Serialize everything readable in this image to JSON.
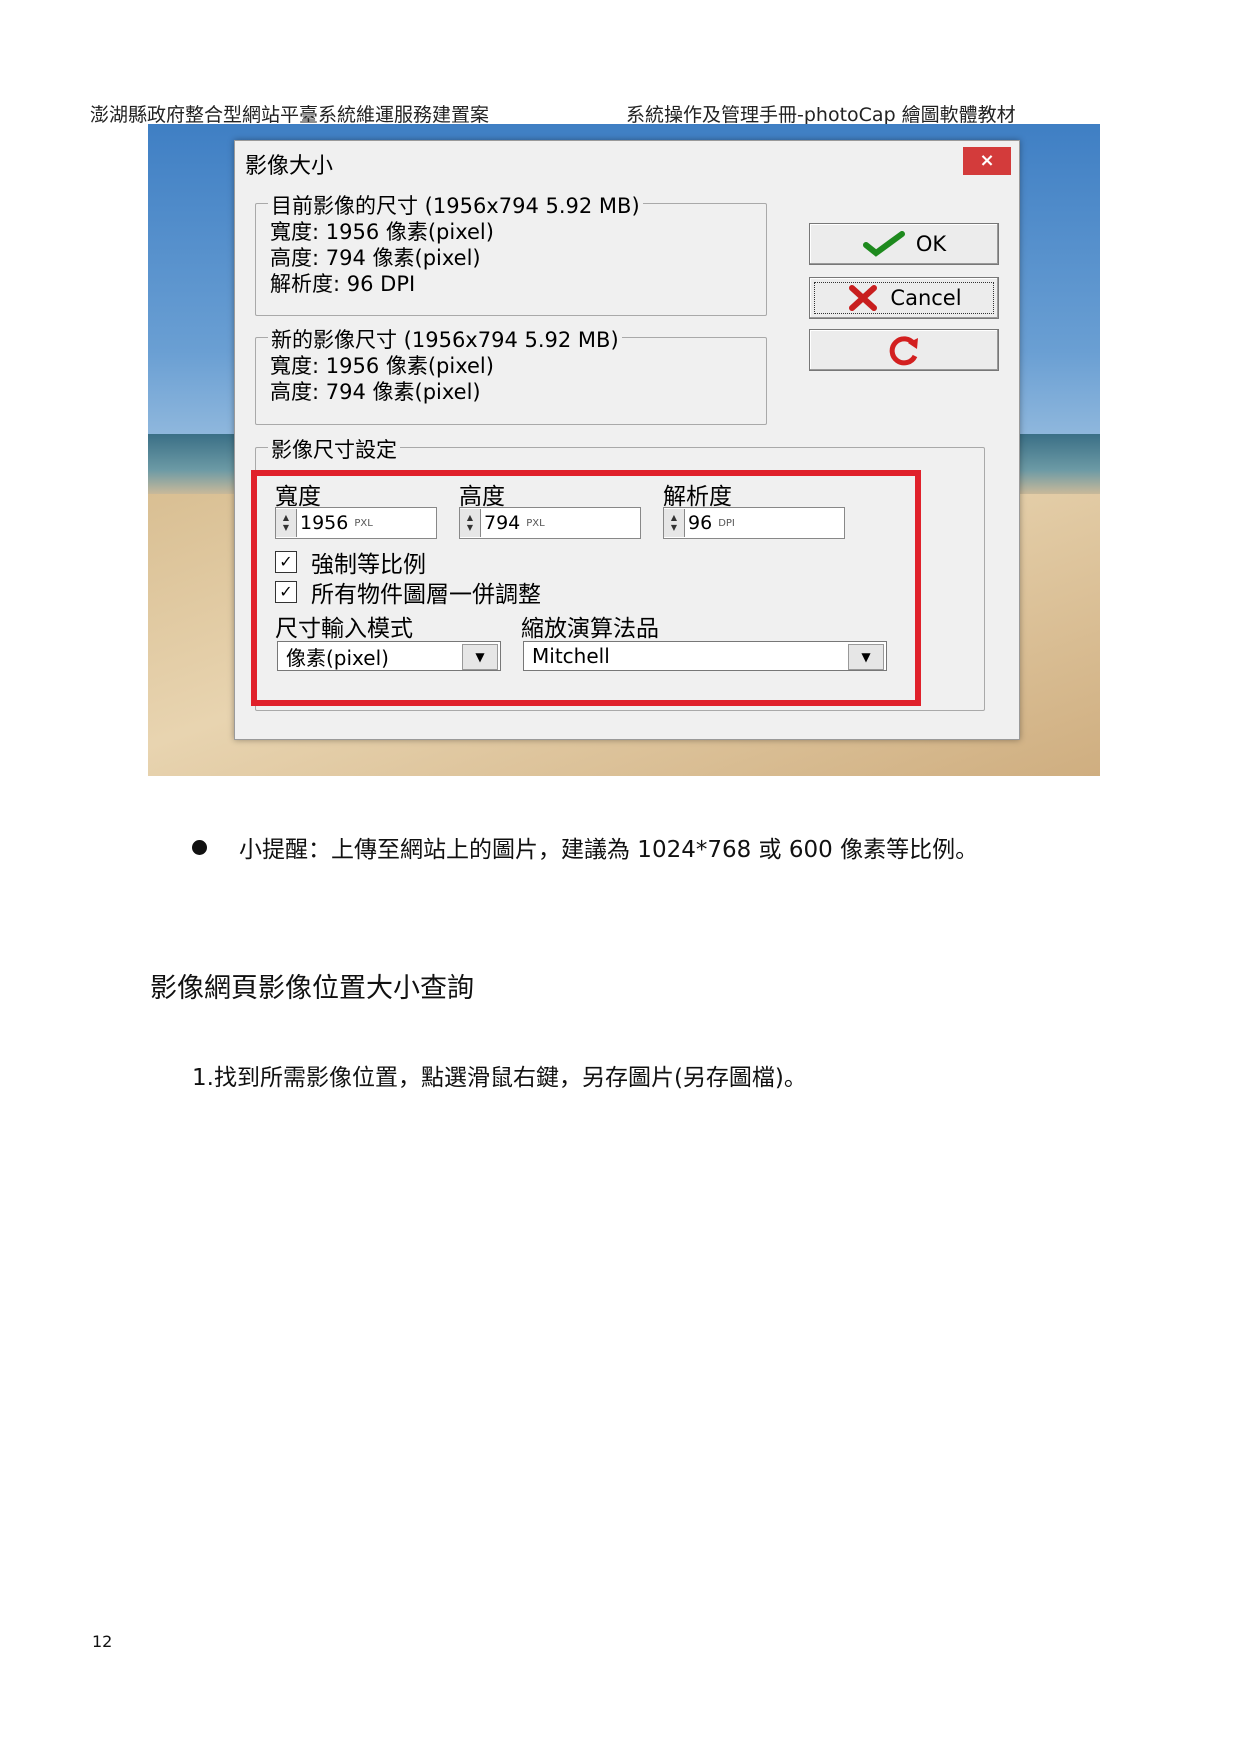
{
  "header": {
    "left": "澎湖縣政府整合型網站平臺系統維運服務建置案",
    "right": "系統操作及管理手冊-photoCap 繪圖軟體教材"
  },
  "dialog": {
    "title": "影像大小",
    "close_label": "×",
    "current": {
      "legend": "目前影像的尺寸 (1956x794  5.92 MB)",
      "width": "寬度: 1956 像素(pixel)",
      "height": "高度: 794 像素(pixel)",
      "resolution": "解析度: 96 DPI"
    },
    "new": {
      "legend": "新的影像尺寸 (1956x794  5.92 MB)",
      "width": "寬度: 1956 像素(pixel)",
      "height": "高度: 794 像素(pixel)"
    },
    "buttons": {
      "ok": "OK",
      "cancel": "Cancel"
    },
    "settings": {
      "legend": "影像尺寸設定",
      "width_label": "寬度",
      "height_label": "高度",
      "resolution_label": "解析度",
      "width_value": "1956",
      "height_value": "794",
      "resolution_value": "96",
      "unit_pixel": "PXL",
      "unit_dpi": "DPI",
      "keep_ratio": "強制等比例",
      "adjust_layers": "所有物件圖層一併調整",
      "input_mode_label": "尺寸輸入模式",
      "algorithm_label": "縮放演算法品",
      "input_mode_value": "像素(pixel)",
      "algorithm_value": "Mitchell"
    },
    "highlight_color": "#e0212b"
  },
  "body": {
    "tip": "小提醒：上傳至網站上的圖片，建議為 1024*768 或 600 像素等比例。",
    "section_title": "影像網頁影像位置大小查詢",
    "step1": "1.找到所需影像位置，點選滑鼠右鍵，另存圖片(另存圖檔)。"
  },
  "page_number": "12"
}
